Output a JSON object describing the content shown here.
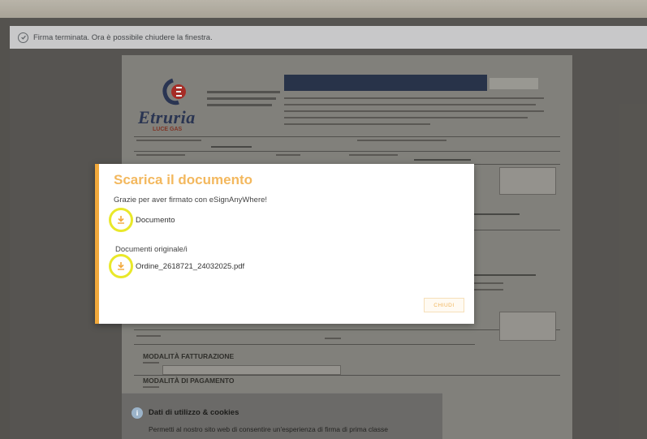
{
  "notification": {
    "icon": "check-circle-icon",
    "text": "Firma terminata. Ora è possibile chiudere la finestra."
  },
  "document": {
    "brand": "Etruria",
    "brand_sub": "LUCE GAS",
    "section_billing": "MODALITÀ FATTURAZIONE",
    "section_payment": "MODALITÀ DI PAGAMENTO"
  },
  "modal": {
    "title": "Scarica il documento",
    "subtitle": "Grazie per aver firmato con eSignAnyWhere!",
    "items": [
      {
        "icon": "download-icon",
        "label": "Documento"
      },
      {
        "icon": "download-icon",
        "label": "Ordine_2618721_24032025.pdf"
      }
    ],
    "group_label": "Documenti originale/i",
    "close_label": "CHIUDI"
  },
  "cookie_banner": {
    "icon": "info-icon",
    "title": "Dati di utilizzo & cookies",
    "text": "Permetti al nostro sito web di consentire un'esperienza di firma di prima classe"
  },
  "colors": {
    "accent": "#f2a93b",
    "highlight_ring": "#e9e82a",
    "brand_navy": "#2c3850"
  }
}
